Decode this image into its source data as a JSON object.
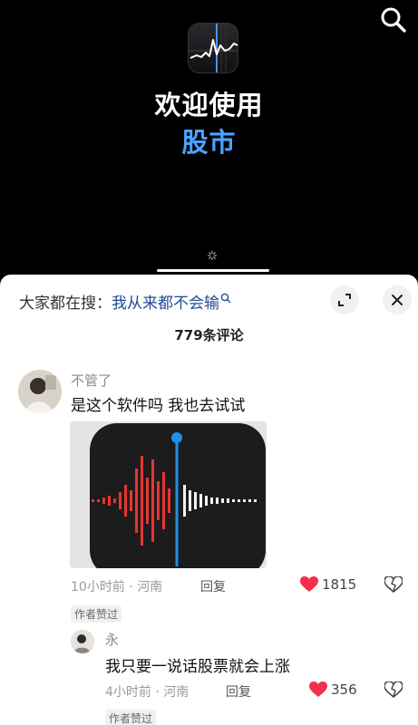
{
  "video": {
    "welcome_text": "欢迎使用",
    "app_name": "股市",
    "search_icon": "search-icon",
    "app_icon": "stocks-app-icon"
  },
  "comments_panel": {
    "hot_search_prefix": "大家都在搜：",
    "hot_search_term": "我从来都不会输",
    "comment_count": "779条评论",
    "comments": [
      {
        "username": "不管了",
        "text": "是这个软件吗 我也去试试",
        "image": "voice-memos-app-icon",
        "time": "10小时前",
        "location": "河南",
        "reply_label": "回复",
        "likes": "1815",
        "badge": "作者赞过"
      }
    ],
    "replies": [
      {
        "username": "永",
        "text": "我只要一说话股票就会上涨",
        "time": "4小时前",
        "location": "河南",
        "reply_label": "回复",
        "likes": "356",
        "badge": "作者赞过"
      }
    ]
  },
  "colors": {
    "accent_blue": "#4aa3ff",
    "like_red": "#f2304c",
    "hot_search_blue": "#1f4d93"
  }
}
